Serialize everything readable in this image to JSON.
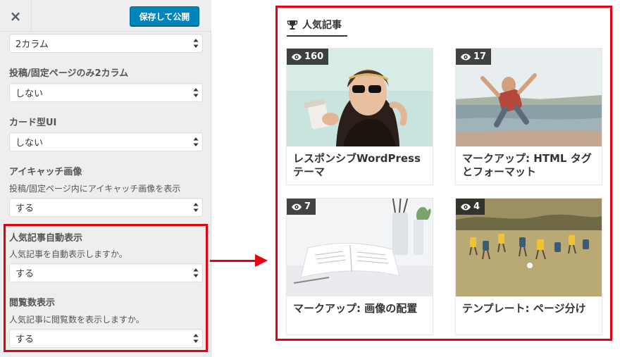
{
  "customizer": {
    "close_glyph": "×",
    "save_label": "保存して公開",
    "fields": {
      "layout_value": "2カラム",
      "post_page_2col": {
        "label": "投稿/固定ページのみ2カラム",
        "value": "しない"
      },
      "card_ui": {
        "label": "カード型UI",
        "value": "しない"
      },
      "eyecatch": {
        "label": "アイキャッチ画像",
        "description": "投稿/固定ページ内にアイキャッチ画像を表示",
        "value": "する"
      },
      "popular_auto": {
        "label": "人気記事自動表示",
        "description": "人気記事を自動表示しますか。",
        "value": "する"
      },
      "view_count": {
        "label": "閲覧数表示",
        "description": "人気記事に閲覧数を表示しますか。",
        "value": "する"
      }
    }
  },
  "preview": {
    "widget_title": "人気記事",
    "title_icon": "trophy-icon",
    "posts": [
      {
        "views": "160",
        "title": "レスポンシブWordPressテーマ"
      },
      {
        "views": "17",
        "title": "マークアップ: HTML タグとフォーマット"
      },
      {
        "views": "7",
        "title": "マークアップ: 画像の配置"
      },
      {
        "views": "4",
        "title": "テンプレート: ページ分け"
      }
    ]
  },
  "colors": {
    "highlight": "#e60012",
    "primary_button": "#0085ba",
    "panel_bg": "#eeeeee"
  }
}
